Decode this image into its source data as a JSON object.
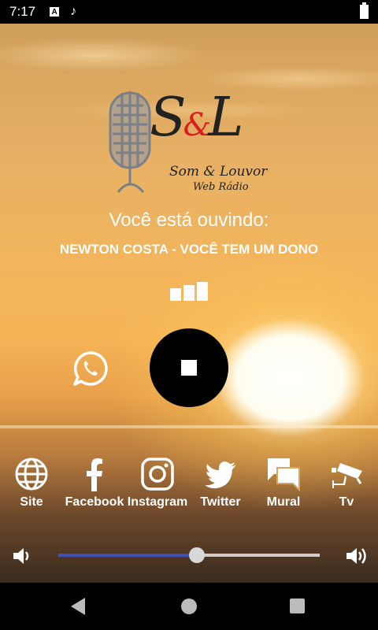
{
  "status": {
    "time": "7:17",
    "a_badge": "A",
    "note_icon": "music-note-icon",
    "battery_icon": "battery-icon"
  },
  "logo": {
    "initials_s": "S",
    "initials_amp": "&",
    "initials_l": "L",
    "name": "Som & Louvor",
    "subtitle": "Web Rádio"
  },
  "player": {
    "listening_label": "Você está ouvindo:",
    "track_title": "NEWTON COSTA - VOCÊ TEM UM DONO",
    "state_icon": "stop-icon"
  },
  "nav": [
    {
      "label": "Site",
      "icon": "globe-icon"
    },
    {
      "label": "Facebook",
      "icon": "facebook-icon"
    },
    {
      "label": "Instagram",
      "icon": "instagram-icon"
    },
    {
      "label": "Twitter",
      "icon": "twitter-icon"
    },
    {
      "label": "Mural",
      "icon": "chat-bubbles-icon"
    },
    {
      "label": "Tv",
      "icon": "cctv-icon"
    }
  ],
  "volume": {
    "level": 0.53
  },
  "colors": {
    "slider_fill": "#3f51b5",
    "accent_red": "#d92020"
  }
}
